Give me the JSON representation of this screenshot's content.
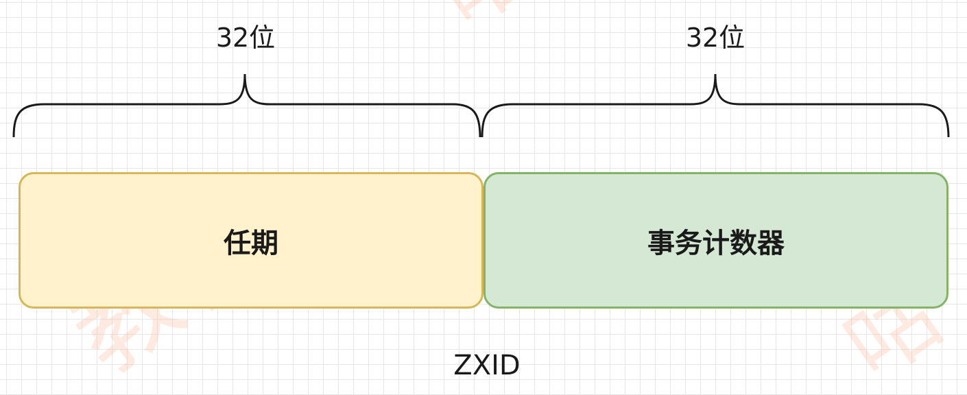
{
  "diagram": {
    "left_segment": {
      "bits_label": "32位",
      "field_label": "任期",
      "fill_color": "#fff2cc",
      "border_color": "#d6b656"
    },
    "right_segment": {
      "bits_label": "32位",
      "field_label": "事务计数器",
      "fill_color": "#d5e8d4",
      "border_color": "#82b366"
    },
    "caption": "ZXID"
  },
  "watermark": {
    "text_1": "教育",
    "text_2": "咕",
    "text_3": "咕"
  }
}
